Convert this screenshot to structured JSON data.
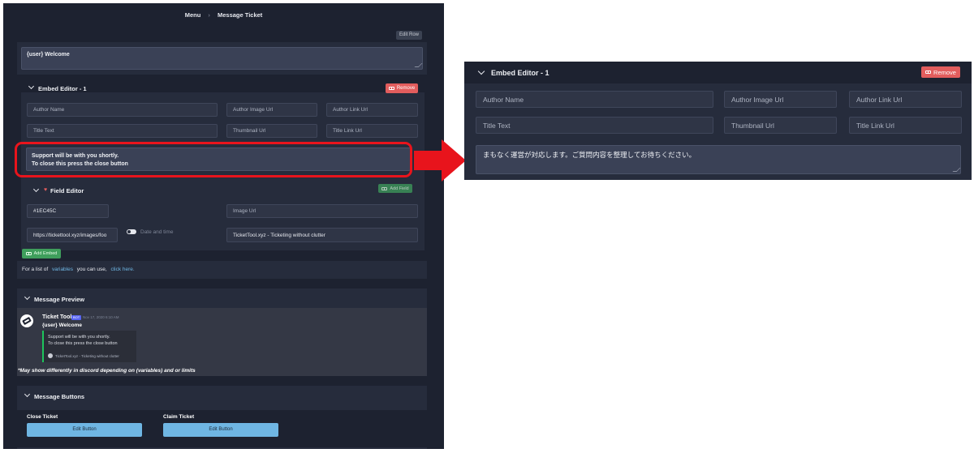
{
  "breadcrumb": {
    "menu": "Menu",
    "current": "Message Ticket"
  },
  "toolbar": {
    "edit_row": "Edit Row"
  },
  "message": {
    "content": "{user} Welcome"
  },
  "embed_editor": {
    "title": "Embed Editor - 1",
    "remove_label": "Remove",
    "author_name": "Author Name",
    "author_image_url": "Author Image Url",
    "author_link_url": "Author Link Url",
    "title_text": "Title Text",
    "thumbnail_url": "Thumbnail Url",
    "title_link_url": "Title Link Url",
    "description_line1": "Support will be with you shortly.",
    "description_line2": "To close this press the close button"
  },
  "field_editor": {
    "title": "Field Editor",
    "add_field_label": "Add Field",
    "color_value": "#1EC45C",
    "image_url": "Image Url",
    "footer_icon_url": "https://tickettool.xyz/images/foo",
    "date_time_label": "Date and time",
    "footer_text": "TicketTool.xyz - Ticketing without clutter"
  },
  "add_embed_label": "Add Embed",
  "variables_note": {
    "prefix": "For a list of",
    "link1": "variables",
    "middle": "you can use,",
    "link2": "click here."
  },
  "message_preview": {
    "title": "Message Preview",
    "bot_name": "Ticket Tool",
    "bot_badge": "BOT",
    "timestamp": "Nov 17, 2020 6:10 AM",
    "content": "{user} Welcome",
    "embed_line1": "Support will be with you shortly.",
    "embed_line2": "To close this press the close button",
    "embed_footer": "TicketTool.xyz - Ticketing without clutter",
    "disclaimer": "*May show differently in discord depending on (variables) and or limits"
  },
  "message_buttons": {
    "title": "Message Buttons",
    "buttons": [
      {
        "label": "Close Ticket",
        "action": "Edit Button"
      },
      {
        "label": "Claim Ticket",
        "action": "Edit Button"
      }
    ]
  },
  "zoom": {
    "title": "Embed Editor - 1",
    "remove_label": "Remove",
    "author_name": "Author Name",
    "author_image_url": "Author Image Url",
    "author_link_url": "Author Link Url",
    "title_text": "Title Text",
    "thumbnail_url": "Thumbnail Url",
    "title_link_url": "Title Link Url",
    "description": "まもなく運営が対応します。ご質問内容を整理してお待ちください。"
  },
  "colors": {
    "accent_red": "#e25d5d",
    "accent_green": "#3f9e5c",
    "accent_blue": "#6fb6e3",
    "highlight": "#e8141c",
    "embed_border": "#1ec45c"
  }
}
